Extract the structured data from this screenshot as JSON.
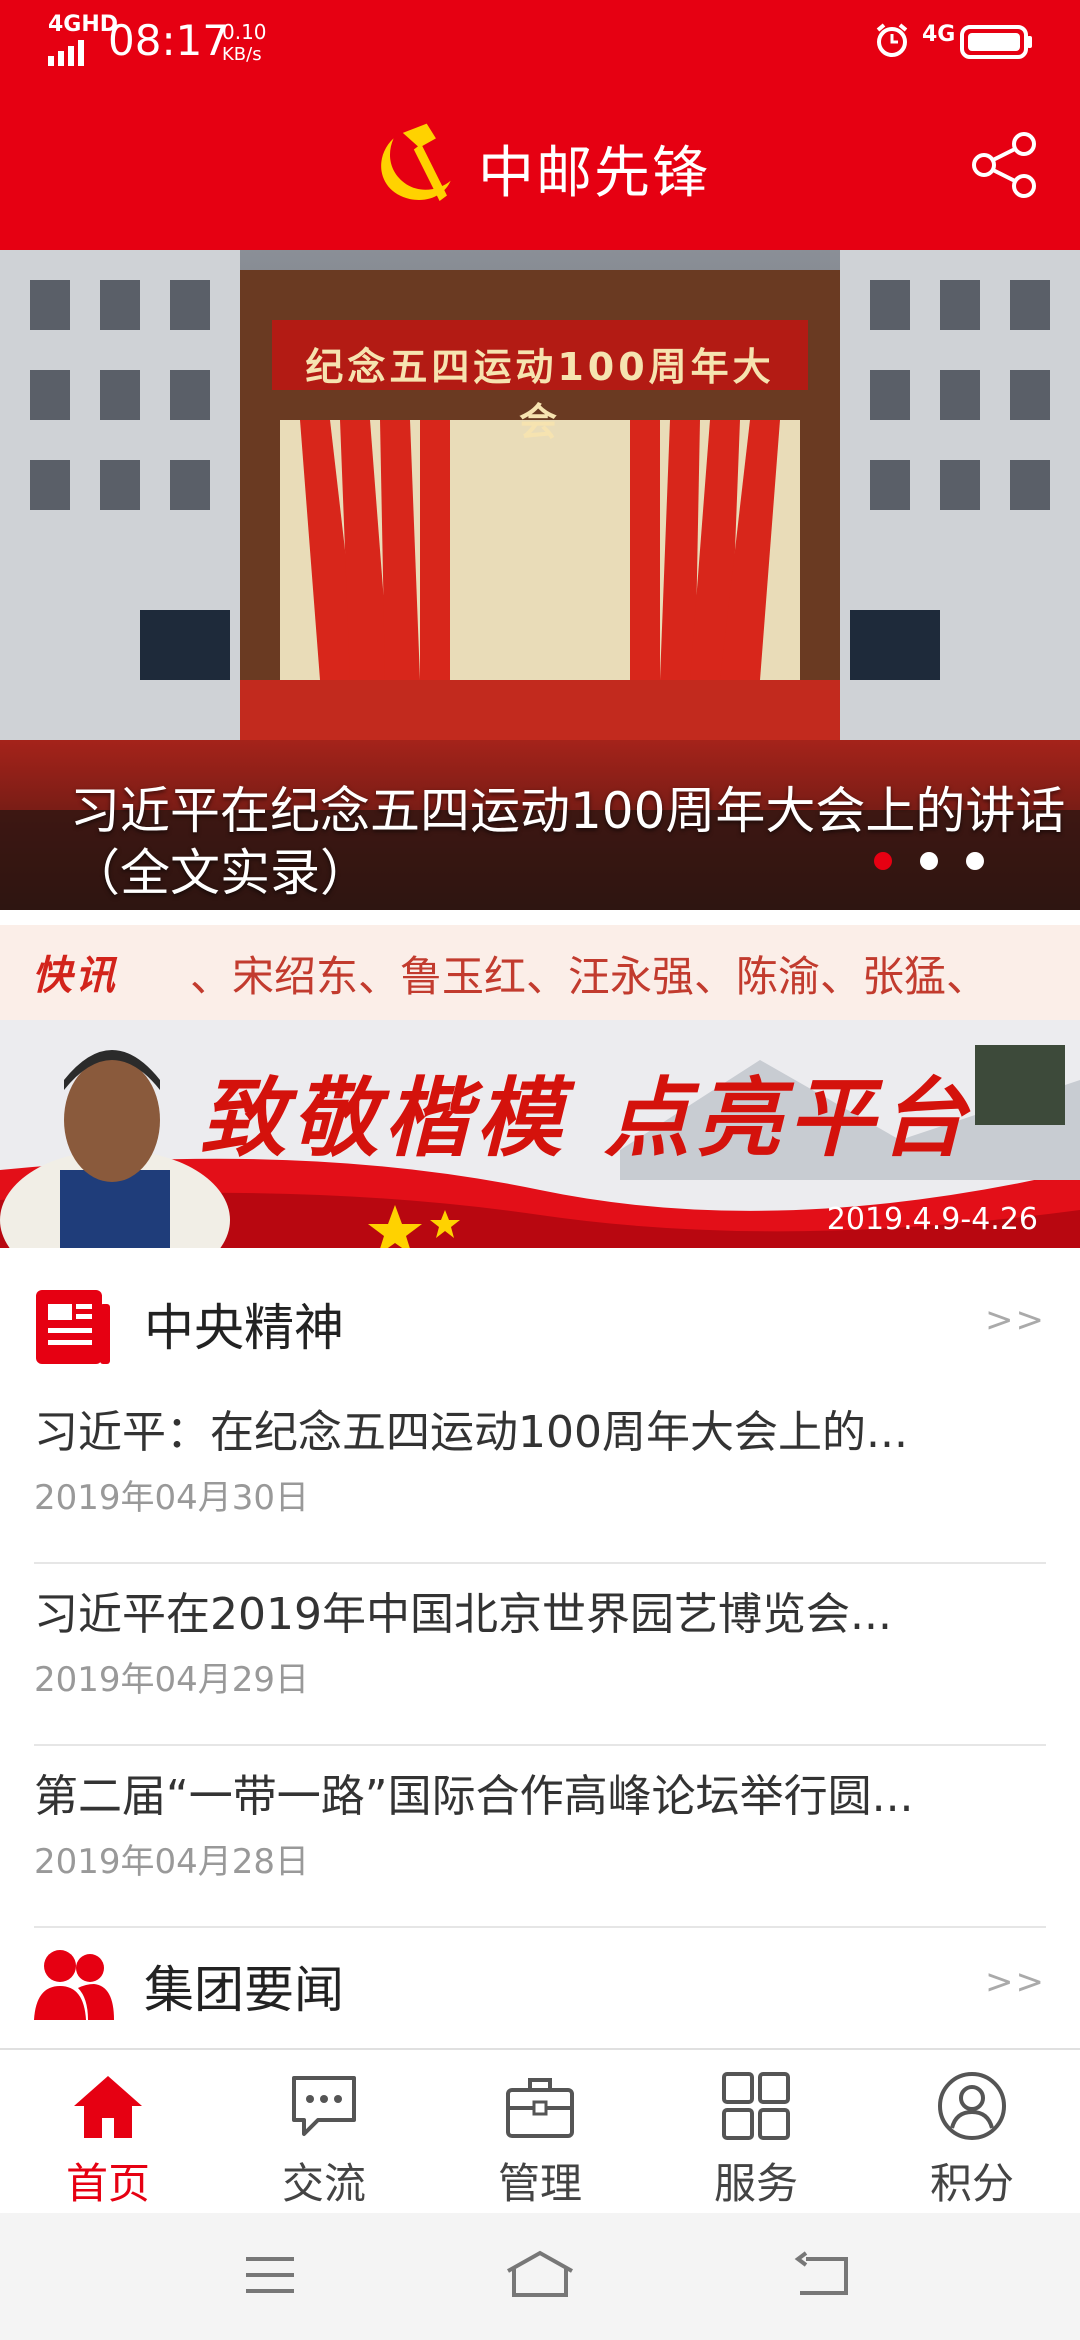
{
  "status_bar": {
    "network": "4GHD",
    "time": "08:17",
    "speed_value": "0.10",
    "speed_unit": "KB/s",
    "network_right": "4G"
  },
  "header": {
    "title": "中邮先锋",
    "logo_icon": "party-emblem-icon",
    "share_icon": "share-icon"
  },
  "banner": {
    "hall_text": "纪念五四运动100周年大会",
    "caption": "习近平在纪念五四运动100周年大会上的讲话（全文实录）",
    "dots": 3,
    "active_dot": 0
  },
  "news_flash": {
    "label": "快讯",
    "text": "、宋绍东、鲁玉红、汪永强、陈渝、张猛、"
  },
  "promo": {
    "title": "致敬楷模 点亮平台",
    "date_range": "2019.4.9-4.26"
  },
  "sections": [
    {
      "title": "中央精神",
      "icon": "document-icon",
      "more": ">>",
      "items": [
        {
          "title": "习近平：在纪念五四运动100周年大会上的...",
          "date": "2019年04月30日"
        },
        {
          "title": "习近平在2019年中国北京世界园艺博览会...",
          "date": "2019年04月29日"
        },
        {
          "title": "第二届“一带一路”国际合作高峰论坛举行圆...",
          "date": "2019年04月28日"
        }
      ]
    },
    {
      "title": "集团要闻",
      "icon": "group-icon",
      "more": ">>",
      "items": []
    }
  ],
  "bottom_nav": [
    {
      "label": "首页",
      "icon": "home-icon",
      "active": true
    },
    {
      "label": "交流",
      "icon": "chat-icon",
      "active": false
    },
    {
      "label": "管理",
      "icon": "briefcase-icon",
      "active": false
    },
    {
      "label": "服务",
      "icon": "grid-icon",
      "active": false
    },
    {
      "label": "积分",
      "icon": "user-circle-icon",
      "active": false
    }
  ],
  "colors": {
    "brand_red": "#e60012",
    "flash_bg": "#fbeee8",
    "active_dot": "#e60012"
  }
}
